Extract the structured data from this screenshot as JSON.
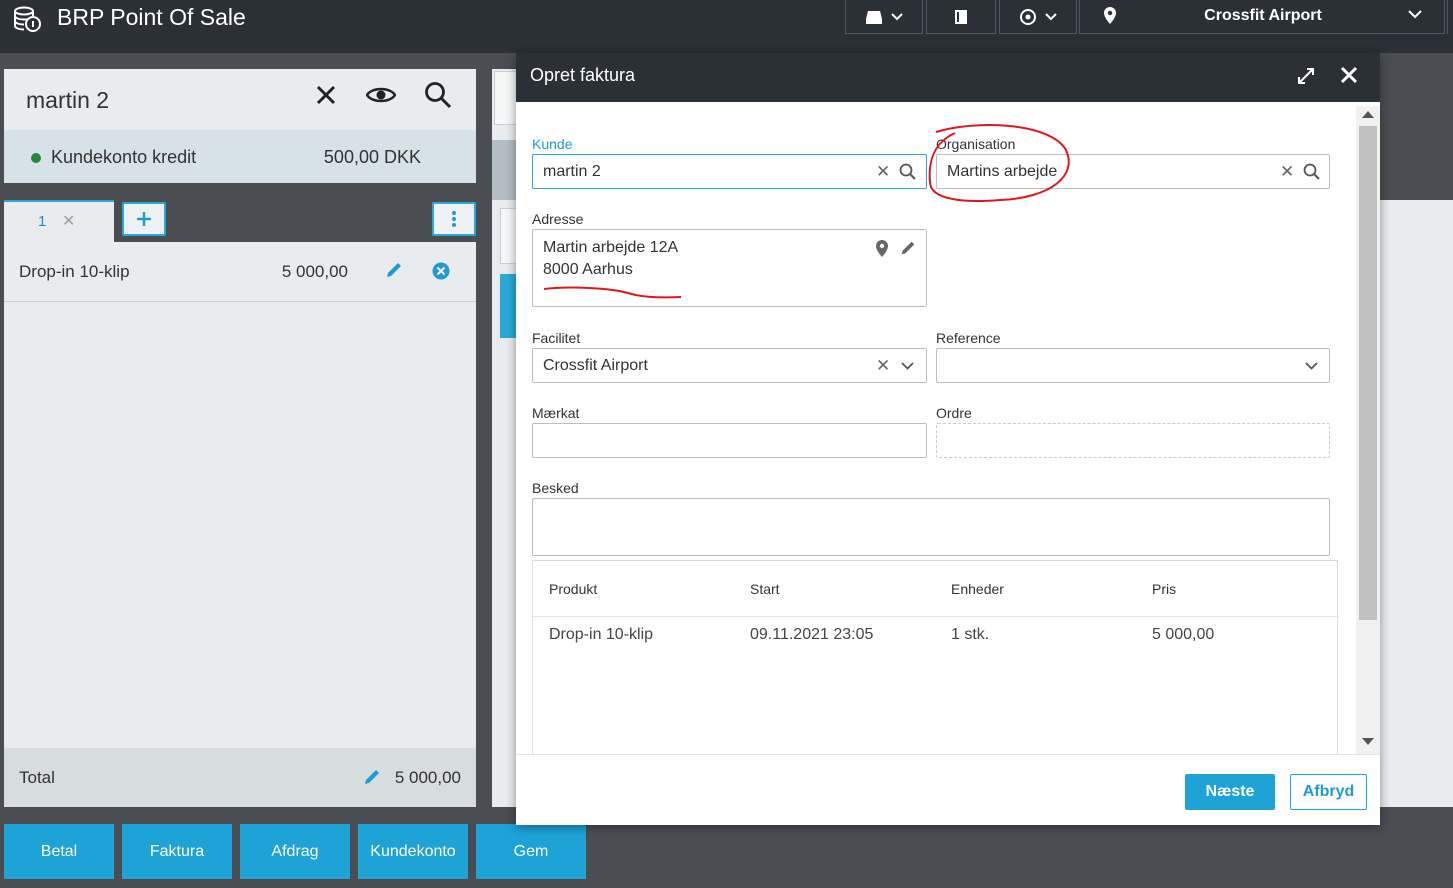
{
  "app": {
    "title": "BRP Point Of Sale"
  },
  "topbar": {
    "location": "Crossfit Airport"
  },
  "customer": {
    "name": "martin 2",
    "credit_label": "Kundekonto kredit",
    "credit_value": "500,00 DKK"
  },
  "cart": {
    "tab_label": "1",
    "items": [
      {
        "name": "Drop-in 10-klip",
        "price": "5 000,00"
      }
    ],
    "total_label": "Total",
    "total_value": "5 000,00"
  },
  "actions": [
    "Betal",
    "Faktura",
    "Afdrag",
    "Kundekonto",
    "Gem"
  ],
  "modal": {
    "title": "Opret faktura",
    "fields": {
      "kunde": {
        "label": "Kunde",
        "value": "martin 2"
      },
      "organisation": {
        "label": "Organisation",
        "value": "Martins arbejde"
      },
      "adresse": {
        "label": "Adresse",
        "line1": "Martin arbejde 12A",
        "line2": "8000 Aarhus"
      },
      "facilitet": {
        "label": "Facilitet",
        "value": "Crossfit Airport"
      },
      "reference": {
        "label": "Reference",
        "value": ""
      },
      "maerkat": {
        "label": "Mærkat",
        "value": ""
      },
      "ordre": {
        "label": "Ordre",
        "value": ""
      },
      "besked": {
        "label": "Besked",
        "value": ""
      }
    },
    "table": {
      "headers": [
        "Produkt",
        "Start",
        "Enheder",
        "Pris"
      ],
      "rows": [
        [
          "Drop-in 10-klip",
          "09.11.2021 23:05",
          "1 stk.",
          "5 000,00"
        ]
      ]
    },
    "next_label": "Næste",
    "cancel_label": "Afbryd"
  },
  "colors": {
    "accent": "#1ea3d6",
    "header": "#2b3036",
    "annotation": "#e0161b",
    "credit_dot": "#1e8a3a"
  }
}
